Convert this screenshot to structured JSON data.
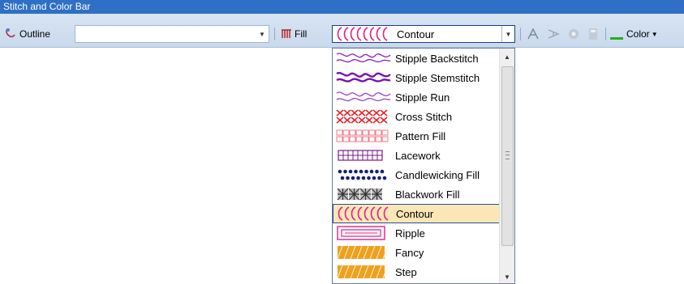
{
  "window": {
    "title": "Stitch and Color Bar"
  },
  "toolbar": {
    "outline_label": "Outline",
    "outline_value": "",
    "fill_label": "Fill",
    "fill_value": "Contour",
    "color_label": "Color",
    "tools": [
      "stitch-angle-icon",
      "reshape-icon",
      "gear-disabled-icon",
      "calculator-disabled-icon"
    ]
  },
  "dropdown": {
    "items": [
      {
        "label": "Stipple Backstitch",
        "icon": "stipple-backstitch-icon",
        "color": "#8a1fbf"
      },
      {
        "label": "Stipple Stemstitch",
        "icon": "stipple-stemstitch-icon",
        "color": "#7a12b0"
      },
      {
        "label": "Stipple Run",
        "icon": "stipple-run-icon",
        "color": "#9a3fd0"
      },
      {
        "label": "Cross Stitch",
        "icon": "cross-stitch-icon",
        "color": "#e8202a"
      },
      {
        "label": "Pattern Fill",
        "icon": "pattern-fill-icon",
        "color": "#f07a8a"
      },
      {
        "label": "Lacework",
        "icon": "lacework-icon",
        "color": "#7a1a8a"
      },
      {
        "label": "Candlewicking Fill",
        "icon": "candlewicking-icon",
        "color": "#14207a"
      },
      {
        "label": "Blackwork Fill",
        "icon": "blackwork-icon",
        "color": "#333333"
      },
      {
        "label": "Contour",
        "icon": "contour-icon",
        "color": "#e0208a",
        "selected": true
      },
      {
        "label": "Ripple",
        "icon": "ripple-icon",
        "color": "#e0208a"
      },
      {
        "label": "Fancy",
        "icon": "fancy-icon",
        "color": "#f0a020"
      },
      {
        "label": "Step",
        "icon": "step-icon",
        "color": "#f0a020"
      }
    ]
  },
  "colors": {
    "accent": "#2f6fc5",
    "selection": "#fbe6b6",
    "selection_border": "#2a4f96"
  }
}
